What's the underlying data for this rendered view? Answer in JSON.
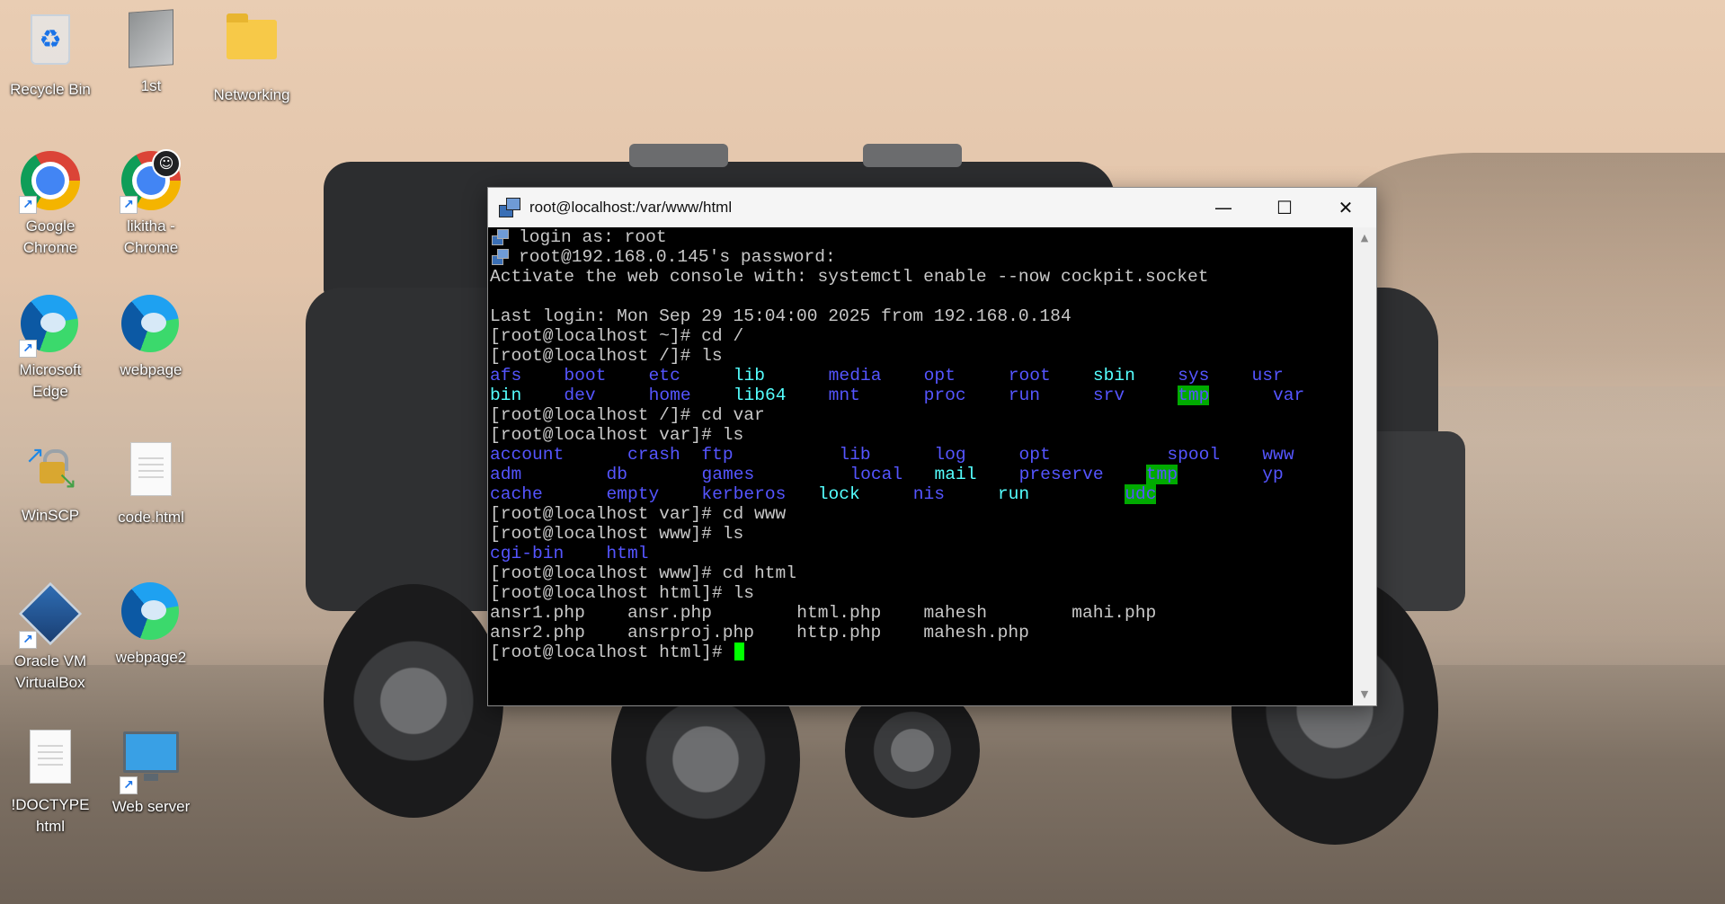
{
  "desktop": {
    "icons": [
      {
        "label": "Recycle Bin"
      },
      {
        "label": "1st"
      },
      {
        "label": "Networking"
      },
      {
        "label": "Google Chrome"
      },
      {
        "label": "likitha - Chrome"
      },
      {
        "label": "Microsoft Edge"
      },
      {
        "label": "webpage"
      },
      {
        "label": "WinSCP"
      },
      {
        "label": "code.html"
      },
      {
        "label": "Oracle VM VirtualBox"
      },
      {
        "label": "webpage2"
      },
      {
        "label": "!DOCTYPE html"
      },
      {
        "label": "Web server"
      }
    ]
  },
  "window": {
    "title": "root@localhost:/var/www/html",
    "minimize_glyph": "—",
    "maximize_glyph": "☐",
    "close_glyph": "✕"
  },
  "terminal": {
    "lines": [
      {
        "segs": [
          {
            "t": "login as: root",
            "c": "n"
          }
        ],
        "icon": true
      },
      {
        "segs": [
          {
            "t": "root@192.168.0.145's password:",
            "c": "n"
          }
        ],
        "icon": true
      },
      {
        "segs": [
          {
            "t": "Activate the web console with: systemctl enable --now cockpit.socket",
            "c": "n"
          }
        ]
      },
      {
        "segs": [
          {
            "t": "",
            "c": "n"
          }
        ]
      },
      {
        "segs": [
          {
            "t": "Last login: Mon Sep 29 15:04:00 2025 from 192.168.0.184",
            "c": "n"
          }
        ]
      },
      {
        "segs": [
          {
            "t": "[root@localhost ~]# cd /",
            "c": "n"
          }
        ]
      },
      {
        "segs": [
          {
            "t": "[root@localhost /]# ls",
            "c": "n"
          }
        ]
      },
      {
        "segs": [
          {
            "t": "afs",
            "c": "blue",
            "w": 5
          },
          {
            "t": "boot",
            "c": "blue",
            "w": 6
          },
          {
            "t": "etc",
            "c": "blue",
            "w": 6
          },
          {
            "t": "lib",
            "c": "cyan",
            "w": 7
          },
          {
            "t": "media",
            "c": "blue",
            "w": 7
          },
          {
            "t": "opt",
            "c": "blue",
            "w": 6
          },
          {
            "t": "root",
            "c": "blue",
            "w": 6
          },
          {
            "t": "sbin",
            "c": "cyan",
            "w": 6
          },
          {
            "t": "sys",
            "c": "blue",
            "w": 5
          },
          {
            "t": "usr",
            "c": "blue",
            "w": 3
          }
        ]
      },
      {
        "segs": [
          {
            "t": "bin",
            "c": "cyan",
            "w": 5
          },
          {
            "t": "dev",
            "c": "blue",
            "w": 6
          },
          {
            "t": "home",
            "c": "blue",
            "w": 6
          },
          {
            "t": "lib64",
            "c": "cyan",
            "w": 7
          },
          {
            "t": "mnt",
            "c": "blue",
            "w": 7
          },
          {
            "t": "proc",
            "c": "blue",
            "w": 6
          },
          {
            "t": "run",
            "c": "blue",
            "w": 6
          },
          {
            "t": "srv",
            "c": "blue",
            "w": 6
          },
          {
            "t": "tmp",
            "c": "tmpbg",
            "w": 3
          },
          {
            "t": "",
            "c": "n",
            "w": 2
          },
          {
            "t": "var",
            "c": "blue",
            "w": 3
          }
        ]
      },
      {
        "segs": [
          {
            "t": "[root@localhost /]# cd var",
            "c": "n"
          }
        ]
      },
      {
        "segs": [
          {
            "t": "[root@localhost var]# ls",
            "c": "n"
          }
        ]
      },
      {
        "segs": [
          {
            "t": "account",
            "c": "blue",
            "w": 11
          },
          {
            "t": "crash",
            "c": "blue",
            "w": 5
          },
          {
            "t": "ftp",
            "c": "blue",
            "w": 11
          },
          {
            "t": "lib",
            "c": "blue",
            "w": 7
          },
          {
            "t": "log",
            "c": "blue",
            "w": 6
          },
          {
            "t": "opt",
            "c": "blue",
            "w": 12
          },
          {
            "t": "spool",
            "c": "blue",
            "w": 7
          },
          {
            "t": "www",
            "c": "blue",
            "w": 3
          }
        ]
      },
      {
        "segs": [
          {
            "t": "adm",
            "c": "blue",
            "w": 9
          },
          {
            "t": "db",
            "c": "blue",
            "w": 7
          },
          {
            "t": "games",
            "c": "blue",
            "w": 12
          },
          {
            "t": "local",
            "c": "blue",
            "w": 6
          },
          {
            "t": "mail",
            "c": "cyan",
            "w": 6
          },
          {
            "t": "preserve",
            "c": "blue",
            "w": 10
          },
          {
            "t": "tmp",
            "c": "tmpbg",
            "w": 3
          },
          {
            "t": "",
            "c": "n",
            "w": 4
          },
          {
            "t": "yp",
            "c": "blue",
            "w": 2
          }
        ]
      },
      {
        "segs": [
          {
            "t": "cache",
            "c": "blue",
            "w": 9
          },
          {
            "t": "empty",
            "c": "blue",
            "w": 7
          },
          {
            "t": "kerberos",
            "c": "blue",
            "w": 9
          },
          {
            "t": "lock",
            "c": "cyan",
            "w": 7
          },
          {
            "t": "nis",
            "c": "blue",
            "w": 6
          },
          {
            "t": "run",
            "c": "cyan",
            "w": 10
          },
          {
            "t": "udc",
            "c": "tmpbg",
            "w": 3
          }
        ]
      },
      {
        "segs": [
          {
            "t": "[root@localhost var]# cd www",
            "c": "n"
          }
        ]
      },
      {
        "segs": [
          {
            "t": "[root@localhost www]# ls",
            "c": "n"
          }
        ]
      },
      {
        "segs": [
          {
            "t": "cgi-bin",
            "c": "blue",
            "w": 9
          },
          {
            "t": "html",
            "c": "blue",
            "w": 4
          }
        ]
      },
      {
        "segs": [
          {
            "t": "[root@localhost www]# cd html",
            "c": "n"
          }
        ]
      },
      {
        "segs": [
          {
            "t": "[root@localhost html]# ls",
            "c": "n"
          }
        ]
      },
      {
        "segs": [
          {
            "t": "ansr1.php",
            "c": "n",
            "w": 11
          },
          {
            "t": "ansr.php",
            "c": "n",
            "w": 14
          },
          {
            "t": "html.php",
            "c": "n",
            "w": 10
          },
          {
            "t": "mahesh",
            "c": "n",
            "w": 12
          },
          {
            "t": "mahi.php",
            "c": "n",
            "w": 8
          }
        ]
      },
      {
        "segs": [
          {
            "t": "ansr2.php",
            "c": "n",
            "w": 11
          },
          {
            "t": "ansrproj.php",
            "c": "n",
            "w": 14
          },
          {
            "t": "http.php",
            "c": "n",
            "w": 10
          },
          {
            "t": "mahesh.php",
            "c": "n",
            "w": 10
          }
        ]
      },
      {
        "segs": [
          {
            "t": "[root@localhost html]# ",
            "c": "n"
          }
        ],
        "cursor": true
      }
    ]
  }
}
